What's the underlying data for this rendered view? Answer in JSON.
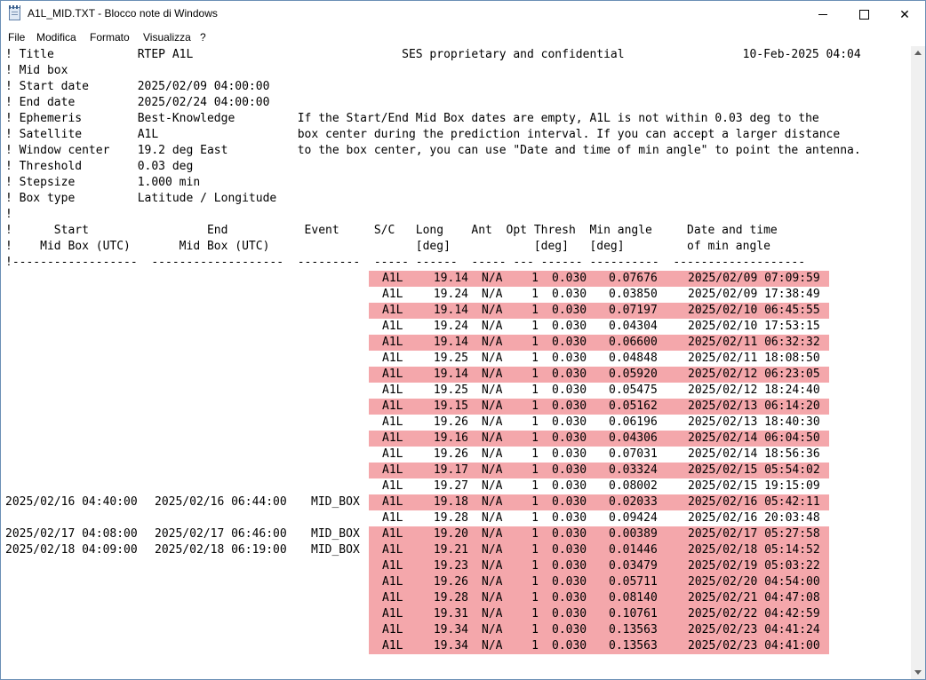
{
  "window": {
    "title": "A1L_MID.TXT - Blocco note di Windows",
    "min_glyph": "",
    "max_glyph": "",
    "close_glyph": "✕"
  },
  "menu": [
    "File",
    "Modifica",
    "Formato",
    "Visualizza",
    "?"
  ],
  "header": {
    "title_line": "! Title            RTEP A1L                              SES proprietary and confidential                 10-Feb-2025 04:04",
    "lines": [
      "! Mid box",
      "! Start date       2025/02/09 04:00:00",
      "! End date         2025/02/24 04:00:00",
      "! Ephemeris        Best-Knowledge         If the Start/End Mid Box dates are empty, A1L is not within 0.03 deg to the",
      "! Satellite        A1L                    box center during the prediction interval. If you can accept a larger distance",
      "! Window center    19.2 deg East          to the box center, you can use \"Date and time of min angle\" to point the antenna.",
      "! Threshold        0.03 deg",
      "! Stepsize         1.000 min",
      "! Box type         Latitude / Longitude",
      "!",
      "!      Start                 End           Event     S/C   Long    Ant  Opt Thresh  Min angle     Date and time",
      "!    Mid Box (UTC)       Mid Box (UTC)                     [deg]            [deg]   [deg]         of min angle",
      "!------------------  -------------------  ---------  ----- ------  ----- --- ------ ----------  -------------------"
    ]
  },
  "rows": [
    {
      "start": "",
      "end": "",
      "event": "",
      "sc": "A1L",
      "long": "19.14",
      "ant": "N/A",
      "opt": "1",
      "thresh": "0.030",
      "min": "0.07676",
      "date": "2025/02/09 07:09:59",
      "hl": true
    },
    {
      "start": "",
      "end": "",
      "event": "",
      "sc": "A1L",
      "long": "19.24",
      "ant": "N/A",
      "opt": "1",
      "thresh": "0.030",
      "min": "0.03850",
      "date": "2025/02/09 17:38:49",
      "hl": false
    },
    {
      "start": "",
      "end": "",
      "event": "",
      "sc": "A1L",
      "long": "19.14",
      "ant": "N/A",
      "opt": "1",
      "thresh": "0.030",
      "min": "0.07197",
      "date": "2025/02/10 06:45:55",
      "hl": true
    },
    {
      "start": "",
      "end": "",
      "event": "",
      "sc": "A1L",
      "long": "19.24",
      "ant": "N/A",
      "opt": "1",
      "thresh": "0.030",
      "min": "0.04304",
      "date": "2025/02/10 17:53:15",
      "hl": false
    },
    {
      "start": "",
      "end": "",
      "event": "",
      "sc": "A1L",
      "long": "19.14",
      "ant": "N/A",
      "opt": "1",
      "thresh": "0.030",
      "min": "0.06600",
      "date": "2025/02/11 06:32:32",
      "hl": true
    },
    {
      "start": "",
      "end": "",
      "event": "",
      "sc": "A1L",
      "long": "19.25",
      "ant": "N/A",
      "opt": "1",
      "thresh": "0.030",
      "min": "0.04848",
      "date": "2025/02/11 18:08:50",
      "hl": false
    },
    {
      "start": "",
      "end": "",
      "event": "",
      "sc": "A1L",
      "long": "19.14",
      "ant": "N/A",
      "opt": "1",
      "thresh": "0.030",
      "min": "0.05920",
      "date": "2025/02/12 06:23:05",
      "hl": true
    },
    {
      "start": "",
      "end": "",
      "event": "",
      "sc": "A1L",
      "long": "19.25",
      "ant": "N/A",
      "opt": "1",
      "thresh": "0.030",
      "min": "0.05475",
      "date": "2025/02/12 18:24:40",
      "hl": false
    },
    {
      "start": "",
      "end": "",
      "event": "",
      "sc": "A1L",
      "long": "19.15",
      "ant": "N/A",
      "opt": "1",
      "thresh": "0.030",
      "min": "0.05162",
      "date": "2025/02/13 06:14:20",
      "hl": true
    },
    {
      "start": "",
      "end": "",
      "event": "",
      "sc": "A1L",
      "long": "19.26",
      "ant": "N/A",
      "opt": "1",
      "thresh": "0.030",
      "min": "0.06196",
      "date": "2025/02/13 18:40:30",
      "hl": false
    },
    {
      "start": "",
      "end": "",
      "event": "",
      "sc": "A1L",
      "long": "19.16",
      "ant": "N/A",
      "opt": "1",
      "thresh": "0.030",
      "min": "0.04306",
      "date": "2025/02/14 06:04:50",
      "hl": true
    },
    {
      "start": "",
      "end": "",
      "event": "",
      "sc": "A1L",
      "long": "19.26",
      "ant": "N/A",
      "opt": "1",
      "thresh": "0.030",
      "min": "0.07031",
      "date": "2025/02/14 18:56:36",
      "hl": false
    },
    {
      "start": "",
      "end": "",
      "event": "",
      "sc": "A1L",
      "long": "19.17",
      "ant": "N/A",
      "opt": "1",
      "thresh": "0.030",
      "min": "0.03324",
      "date": "2025/02/15 05:54:02",
      "hl": true
    },
    {
      "start": "",
      "end": "",
      "event": "",
      "sc": "A1L",
      "long": "19.27",
      "ant": "N/A",
      "opt": "1",
      "thresh": "0.030",
      "min": "0.08002",
      "date": "2025/02/15 19:15:09",
      "hl": false
    },
    {
      "start": "2025/02/16 04:40:00",
      "end": "2025/02/16 06:44:00",
      "event": "MID_BOX",
      "sc": "A1L",
      "long": "19.18",
      "ant": "N/A",
      "opt": "1",
      "thresh": "0.030",
      "min": "0.02033",
      "date": "2025/02/16 05:42:11",
      "hl": true
    },
    {
      "start": "",
      "end": "",
      "event": "",
      "sc": "A1L",
      "long": "19.28",
      "ant": "N/A",
      "opt": "1",
      "thresh": "0.030",
      "min": "0.09424",
      "date": "2025/02/16 20:03:48",
      "hl": false
    },
    {
      "start": "2025/02/17 04:08:00",
      "end": "2025/02/17 06:46:00",
      "event": "MID_BOX",
      "sc": "A1L",
      "long": "19.20",
      "ant": "N/A",
      "opt": "1",
      "thresh": "0.030",
      "min": "0.00389",
      "date": "2025/02/17 05:27:58",
      "hl": true
    },
    {
      "start": "2025/02/18 04:09:00",
      "end": "2025/02/18 06:19:00",
      "event": "MID_BOX",
      "sc": "A1L",
      "long": "19.21",
      "ant": "N/A",
      "opt": "1",
      "thresh": "0.030",
      "min": "0.01446",
      "date": "2025/02/18 05:14:52",
      "hl": true
    },
    {
      "start": "",
      "end": "",
      "event": "",
      "sc": "A1L",
      "long": "19.23",
      "ant": "N/A",
      "opt": "1",
      "thresh": "0.030",
      "min": "0.03479",
      "date": "2025/02/19 05:03:22",
      "hl": true
    },
    {
      "start": "",
      "end": "",
      "event": "",
      "sc": "A1L",
      "long": "19.26",
      "ant": "N/A",
      "opt": "1",
      "thresh": "0.030",
      "min": "0.05711",
      "date": "2025/02/20 04:54:00",
      "hl": true
    },
    {
      "start": "",
      "end": "",
      "event": "",
      "sc": "A1L",
      "long": "19.28",
      "ant": "N/A",
      "opt": "1",
      "thresh": "0.030",
      "min": "0.08140",
      "date": "2025/02/21 04:47:08",
      "hl": true
    },
    {
      "start": "",
      "end": "",
      "event": "",
      "sc": "A1L",
      "long": "19.31",
      "ant": "N/A",
      "opt": "1",
      "thresh": "0.030",
      "min": "0.10761",
      "date": "2025/02/22 04:42:59",
      "hl": true
    },
    {
      "start": "",
      "end": "",
      "event": "",
      "sc": "A1L",
      "long": "19.34",
      "ant": "N/A",
      "opt": "1",
      "thresh": "0.030",
      "min": "0.13563",
      "date": "2025/02/23 04:41:24",
      "hl": true
    },
    {
      "start": "",
      "end": "",
      "event": "",
      "sc": "A1L",
      "long": "19.34",
      "ant": "N/A",
      "opt": "1",
      "thresh": "0.030",
      "min": "0.13563",
      "date": "2025/02/23 04:41:00",
      "hl": true
    }
  ],
  "colors": {
    "highlight": "#f4a7ab"
  }
}
